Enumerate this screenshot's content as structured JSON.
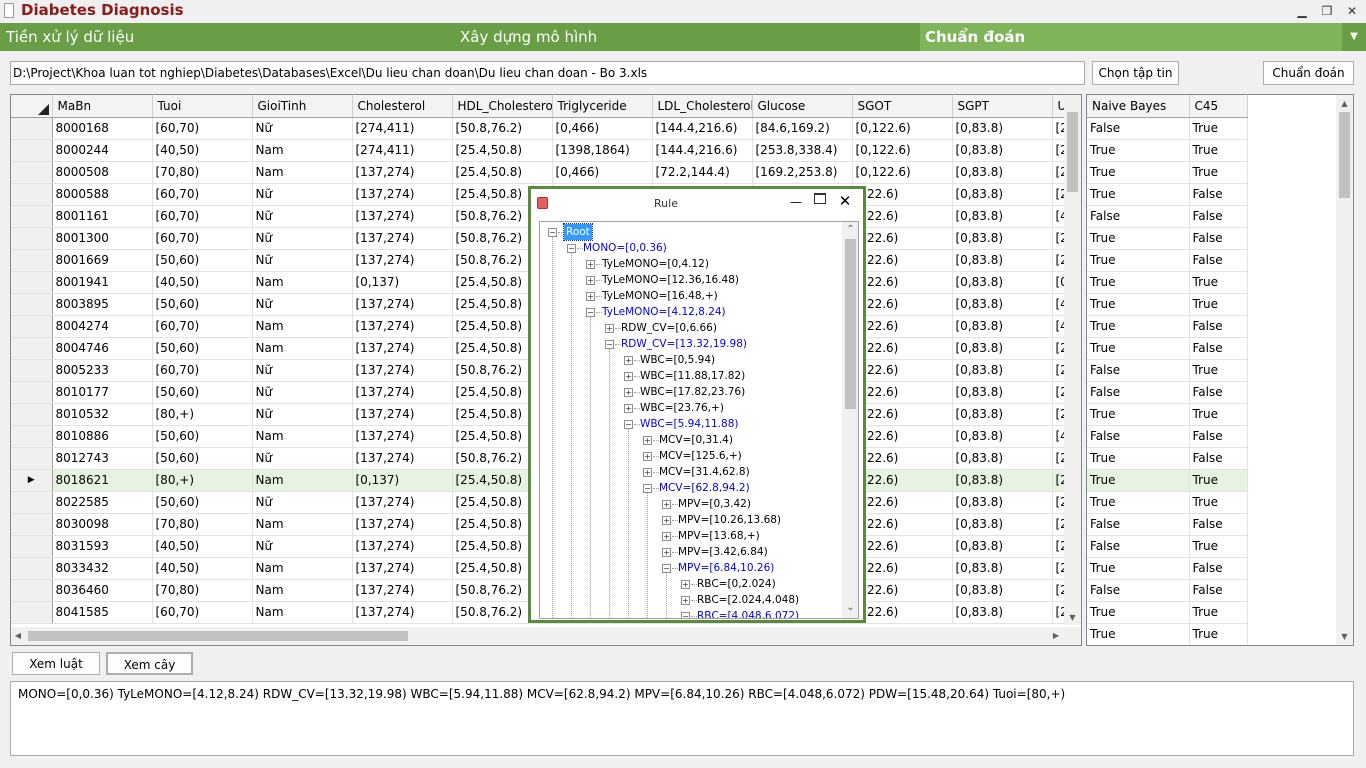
{
  "window": {
    "title": "Diabetes Diagnosis",
    "min_glyph": "▁",
    "restore_glyph": "❐",
    "close_glyph": "✕"
  },
  "menu": {
    "items": [
      "Tiền xử lý dữ liệu",
      "Xây dựng mô hình",
      "Chuẩn đoán"
    ],
    "active_index": 2,
    "arrow_glyph": "▼"
  },
  "colors": {
    "menu_bg": "#6a9e46",
    "menu_active": "#7fb45a",
    "title_red": "#8b1a1a",
    "tree_blue": "#0000e6",
    "selected_row": "#e7f3e1"
  },
  "file": {
    "path": "D:\\Project\\Khoa luan tot nghiep\\Diabetes\\Databases\\Excel\\Du lieu chan doan\\Du lieu chan doan - Bo 3.xls",
    "choose_label": "Chọn tập tin",
    "diagnose_label": "Chuẩn đoán"
  },
  "grid": {
    "columns": [
      "MaBn",
      "Tuoi",
      "GioiTinh",
      "Cholesterol",
      "HDL_Cholestero",
      "Triglyceride",
      "LDL_Cholesterol",
      "Glucose",
      "SGOT",
      "SGPT",
      "U"
    ],
    "selected_row_index": 16,
    "rows": [
      [
        "8000168",
        "[60,70)",
        "Nữ",
        "[274,411)",
        "[50.8,76.2)",
        "[0,466)",
        "[144.4,216.6)",
        "[84.6,169.2)",
        "[0,122.6)",
        "[0,83.8)",
        "[2"
      ],
      [
        "8000244",
        "[40,50)",
        "Nam",
        "[274,411)",
        "[25.4,50.8)",
        "[1398,1864)",
        "[144.4,216.6)",
        "[253.8,338.4)",
        "[0,122.6)",
        "[0,83.8)",
        "[2"
      ],
      [
        "8000508",
        "[70,80)",
        "Nam",
        "[137,274)",
        "[25.4,50.8)",
        "[0,466)",
        "[72.2,144.4)",
        "[169.2,253.8)",
        "[0,122.6)",
        "[0,83.8)",
        "[2"
      ],
      [
        "8000588",
        "[60,70)",
        "Nữ",
        "[137,274)",
        "[25.4,50.8)",
        "",
        "",
        "",
        ",122.6)",
        "[0,83.8)",
        "[2"
      ],
      [
        "8001161",
        "[60,70)",
        "Nữ",
        "[137,274)",
        "[50.8,76.2)",
        "",
        "",
        "",
        ",122.6)",
        "[0,83.8)",
        "[4"
      ],
      [
        "8001300",
        "[60,70)",
        "Nữ",
        "[137,274)",
        "[50.8,76.2)",
        "",
        "",
        "",
        ",122.6)",
        "[0,83.8)",
        "[2"
      ],
      [
        "8001669",
        "[50,60)",
        "Nữ",
        "[137,274)",
        "[50.8,76.2)",
        "",
        "",
        "",
        ",122.6)",
        "[0,83.8)",
        "[2"
      ],
      [
        "8001941",
        "[40,50)",
        "Nam",
        "[0,137)",
        "[25.4,50.8)",
        "",
        "",
        "",
        ",122.6)",
        "[0,83.8)",
        "[0"
      ],
      [
        "8003895",
        "[50,60)",
        "Nữ",
        "[137,274)",
        "[25.4,50.8)",
        "",
        "",
        "",
        ",122.6)",
        "[0,83.8)",
        "[4"
      ],
      [
        "8004274",
        "[60,70)",
        "Nam",
        "[137,274)",
        "[25.4,50.8)",
        "",
        "",
        "",
        ",122.6)",
        "[0,83.8)",
        "[4"
      ],
      [
        "8004746",
        "[50,60)",
        "Nam",
        "[137,274)",
        "[25.4,50.8)",
        "",
        "",
        "",
        ",122.6)",
        "[0,83.8)",
        "[2"
      ],
      [
        "8005233",
        "[60,70)",
        "Nữ",
        "[137,274)",
        "[50.8,76.2)",
        "",
        "",
        "",
        ",122.6)",
        "[0,83.8)",
        "[2"
      ],
      [
        "8010177",
        "[50,60)",
        "Nữ",
        "[137,274)",
        "[25.4,50.8)",
        "",
        "",
        "",
        ",122.6)",
        "[0,83.8)",
        "[2"
      ],
      [
        "8010532",
        "[80,+)",
        "Nữ",
        "[137,274)",
        "[25.4,50.8)",
        "",
        "",
        "",
        ",122.6)",
        "[0,83.8)",
        "[2"
      ],
      [
        "8010886",
        "[50,60)",
        "Nam",
        "[137,274)",
        "[25.4,50.8)",
        "",
        "",
        "",
        ",122.6)",
        "[0,83.8)",
        "[4"
      ],
      [
        "8012743",
        "[50,60)",
        "Nữ",
        "[137,274)",
        "[50.8,76.2)",
        "",
        "",
        "",
        ",122.6)",
        "[0,83.8)",
        "[2"
      ],
      [
        "8018621",
        "[80,+)",
        "Nam",
        "[0,137)",
        "[25.4,50.8)",
        "",
        "",
        "",
        ",122.6)",
        "[0,83.8)",
        "[2"
      ],
      [
        "8022585",
        "[50,60)",
        "Nữ",
        "[137,274)",
        "[25.4,50.8)",
        "",
        "",
        "",
        ",122.6)",
        "[0,83.8)",
        "[2"
      ],
      [
        "8030098",
        "[70,80)",
        "Nam",
        "[137,274)",
        "[25.4,50.8)",
        "",
        "",
        "",
        ",122.6)",
        "[0,83.8)",
        "[2"
      ],
      [
        "8031593",
        "[40,50)",
        "Nữ",
        "[137,274)",
        "[25.4,50.8)",
        "",
        "",
        "",
        ",122.6)",
        "[0,83.8)",
        "[2"
      ],
      [
        "8033432",
        "[40,50)",
        "Nam",
        "[137,274)",
        "[25.4,50.8)",
        "",
        "",
        "",
        ",122.6)",
        "[0,83.8)",
        "[2"
      ],
      [
        "8036460",
        "[70,80)",
        "Nam",
        "[137,274)",
        "[50.8,76.2)",
        "",
        "",
        "",
        ",122.6)",
        "[0,83.8)",
        "[2"
      ],
      [
        "8041585",
        "[60,70)",
        "Nam",
        "[137,274)",
        "[50.8,76.2)",
        "",
        "",
        "",
        ",122.6)",
        "[0,83.8)",
        "[2"
      ]
    ]
  },
  "results": {
    "columns": [
      "Naive Bayes",
      "C45"
    ],
    "rows": [
      [
        "False",
        "True"
      ],
      [
        "True",
        "True"
      ],
      [
        "True",
        "True"
      ],
      [
        "True",
        "False"
      ],
      [
        "False",
        "False"
      ],
      [
        "True",
        "False"
      ],
      [
        "True",
        "False"
      ],
      [
        "True",
        "True"
      ],
      [
        "True",
        "True"
      ],
      [
        "True",
        "False"
      ],
      [
        "True",
        "False"
      ],
      [
        "False",
        "True"
      ],
      [
        "False",
        "False"
      ],
      [
        "True",
        "True"
      ],
      [
        "False",
        "False"
      ],
      [
        "True",
        "False"
      ],
      [
        "True",
        "True"
      ],
      [
        "True",
        "True"
      ],
      [
        "False",
        "False"
      ],
      [
        "False",
        "True"
      ],
      [
        "True",
        "False"
      ],
      [
        "False",
        "False"
      ],
      [
        "True",
        "True"
      ],
      [
        "True",
        "True"
      ]
    ]
  },
  "buttons": {
    "view_rules": "Xem luật",
    "view_tree": "Xem cây"
  },
  "rule_text": "MONO=[0,0.36) TyLeMONO=[4.12,8.24) RDW_CV=[13.32,19.98) WBC=[5.94,11.88) MCV=[62.8,94.2) MPV=[6.84,10.26) RBC=[4.048,6.072) PDW=[15.48,20.64) Tuoi=[80,+)",
  "rule_dialog": {
    "title": "Rule",
    "tree": [
      {
        "label": "Root",
        "depth": 0,
        "state": "root",
        "sign": "−"
      },
      {
        "label": "MONO=[0,0.36)",
        "depth": 1,
        "state": "blue",
        "sign": "−"
      },
      {
        "label": "TyLeMONO=[0,4.12)",
        "depth": 2,
        "state": "normal",
        "sign": "+"
      },
      {
        "label": "TyLeMONO=[12.36,16.48)",
        "depth": 2,
        "state": "normal",
        "sign": "+"
      },
      {
        "label": "TyLeMONO=[16.48,+)",
        "depth": 2,
        "state": "normal",
        "sign": "+"
      },
      {
        "label": "TyLeMONO=[4.12,8.24)",
        "depth": 2,
        "state": "blue",
        "sign": "−"
      },
      {
        "label": "RDW_CV=[0,6.66)",
        "depth": 3,
        "state": "normal",
        "sign": "+"
      },
      {
        "label": "RDW_CV=[13.32,19.98)",
        "depth": 3,
        "state": "blue",
        "sign": "−"
      },
      {
        "label": "WBC=[0,5.94)",
        "depth": 4,
        "state": "normal",
        "sign": "+"
      },
      {
        "label": "WBC=[11.88,17.82)",
        "depth": 4,
        "state": "normal",
        "sign": "+"
      },
      {
        "label": "WBC=[17.82,23.76)",
        "depth": 4,
        "state": "normal",
        "sign": "+"
      },
      {
        "label": "WBC=[23.76,+)",
        "depth": 4,
        "state": "normal",
        "sign": "+"
      },
      {
        "label": "WBC=[5.94,11.88)",
        "depth": 4,
        "state": "blue",
        "sign": "−"
      },
      {
        "label": "MCV=[0,31.4)",
        "depth": 5,
        "state": "normal",
        "sign": "+"
      },
      {
        "label": "MCV=[125.6,+)",
        "depth": 5,
        "state": "normal",
        "sign": "+"
      },
      {
        "label": "MCV=[31.4,62.8)",
        "depth": 5,
        "state": "normal",
        "sign": "+"
      },
      {
        "label": "MCV=[62.8,94.2)",
        "depth": 5,
        "state": "blue",
        "sign": "−"
      },
      {
        "label": "MPV=[0,3.42)",
        "depth": 6,
        "state": "normal",
        "sign": "+"
      },
      {
        "label": "MPV=[10.26,13.68)",
        "depth": 6,
        "state": "normal",
        "sign": "+"
      },
      {
        "label": "MPV=[13.68,+)",
        "depth": 6,
        "state": "normal",
        "sign": "+"
      },
      {
        "label": "MPV=[3.42,6.84)",
        "depth": 6,
        "state": "normal",
        "sign": "+"
      },
      {
        "label": "MPV=[6.84,10.26)",
        "depth": 6,
        "state": "blue",
        "sign": "−"
      },
      {
        "label": "RBC=[0,2.024)",
        "depth": 7,
        "state": "normal",
        "sign": "+"
      },
      {
        "label": "RBC=[2.024,4.048)",
        "depth": 7,
        "state": "normal",
        "sign": "+"
      },
      {
        "label": "RBC=[4.048,6.072)",
        "depth": 7,
        "state": "blue",
        "sign": "−"
      }
    ]
  }
}
